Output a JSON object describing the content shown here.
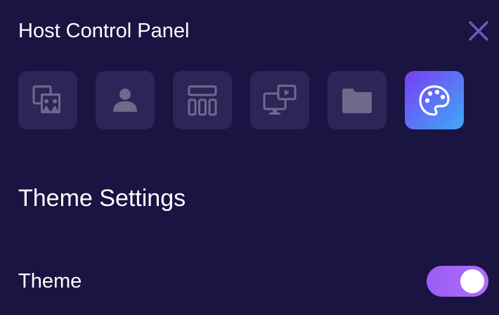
{
  "panel": {
    "title": "Host Control Panel"
  },
  "tabs": [
    {
      "icon": "swap-users-icon",
      "active": false
    },
    {
      "icon": "user-icon",
      "active": false
    },
    {
      "icon": "layout-grid-icon",
      "active": false
    },
    {
      "icon": "screen-media-icon",
      "active": false
    },
    {
      "icon": "folder-icon",
      "active": false
    },
    {
      "icon": "palette-icon",
      "active": true
    }
  ],
  "section": {
    "title": "Theme Settings"
  },
  "settings": {
    "theme": {
      "label": "Theme",
      "enabled": true
    }
  },
  "colors": {
    "background": "#1a1442",
    "tab": "#2c2558",
    "icon": "#6e6a8c",
    "active_gradient_start": "#7a3cf6",
    "active_gradient_end": "#3fa9f5",
    "toggle_on": "#a465f6",
    "close": "#6a5bb8"
  }
}
